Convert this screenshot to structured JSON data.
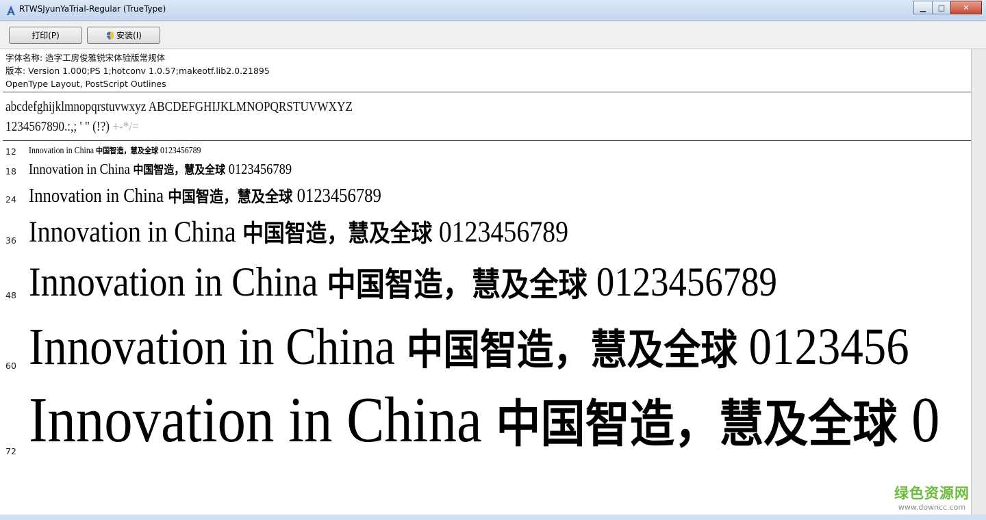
{
  "window": {
    "title": "RTWSJyunYaTrial-Regular (TrueType)",
    "minimize": "▁",
    "maximize": "□",
    "close": "✕"
  },
  "toolbar": {
    "print_label": "打印(P)",
    "install_label": "安装(I)"
  },
  "info": {
    "font_name": "字体名称: 造字工房俊雅锐宋体验版常规体",
    "version": "版本: Version 1.000;PS 1;hotconv 1.0.57;makeotf.lib2.0.21895",
    "type": "OpenType Layout, PostScript Outlines"
  },
  "charset": {
    "line1": "abcdefghijklmnopqrstuvwxyz ABCDEFGHIJKLMNOPQRSTUVWXYZ",
    "line2": "1234567890.:,; ' \" (!?)",
    "line2_light": " +-*/="
  },
  "samples": [
    {
      "size": "12",
      "latin": "Innovation in China ",
      "cjk": "中国智造，慧及全球",
      "digits": " 0123456789"
    },
    {
      "size": "18",
      "latin": "Innovation in China ",
      "cjk": "中国智造，慧及全球",
      "digits": " 0123456789"
    },
    {
      "size": "24",
      "latin": "Innovation in China ",
      "cjk": "中国智造，慧及全球",
      "digits": " 0123456789"
    },
    {
      "size": "36",
      "latin": "Innovation in China ",
      "cjk": "中国智造，慧及全球",
      "digits": " 0123456789"
    },
    {
      "size": "48",
      "latin": "Innovation in China ",
      "cjk": "中国智造，慧及全球",
      "digits": " 0123456789"
    },
    {
      "size": "60",
      "latin": "Innovation in China ",
      "cjk": "中国智造，慧及全球",
      "digits": " 0123456"
    },
    {
      "size": "72",
      "latin": "Innovation in China ",
      "cjk": "中国智造，慧及全球",
      "digits": " 0"
    }
  ],
  "watermark": {
    "name": "绿色资源网",
    "url": "www.downcc.com"
  },
  "icons": {
    "title_icon": "font-icon",
    "install_icon": "shield-icon"
  }
}
